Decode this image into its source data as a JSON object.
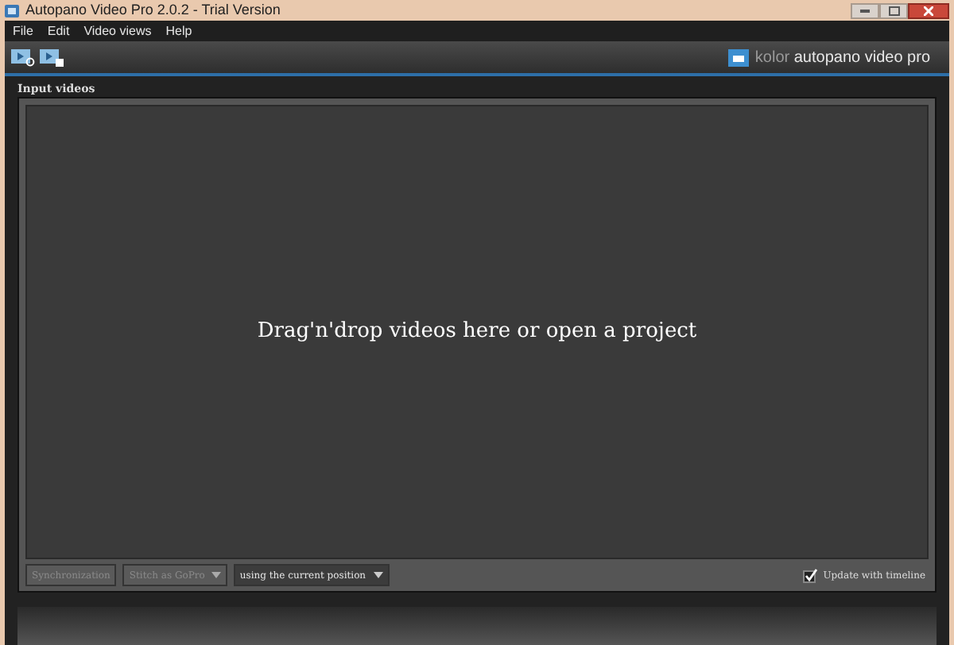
{
  "window": {
    "title": "Autopano Video Pro 2.0.2 - Trial Version"
  },
  "menu": [
    "File",
    "Edit",
    "Video views",
    "Help"
  ],
  "brand": {
    "prefix": "kolor",
    "name": "autopano video pro"
  },
  "panel": {
    "title": "Input videos",
    "drop_hint": "Drag'n'drop videos here or open a project"
  },
  "controls": [
    {
      "kind": "button",
      "label": "Synchronization",
      "disabled": true
    },
    {
      "kind": "dropdown",
      "label": "Stitch as GoPro",
      "disabled": true
    },
    {
      "kind": "dropdown",
      "label": "using the current position",
      "disabled": false
    }
  ],
  "update_with_timeline": {
    "label": "Update with timeline",
    "checked": true
  }
}
